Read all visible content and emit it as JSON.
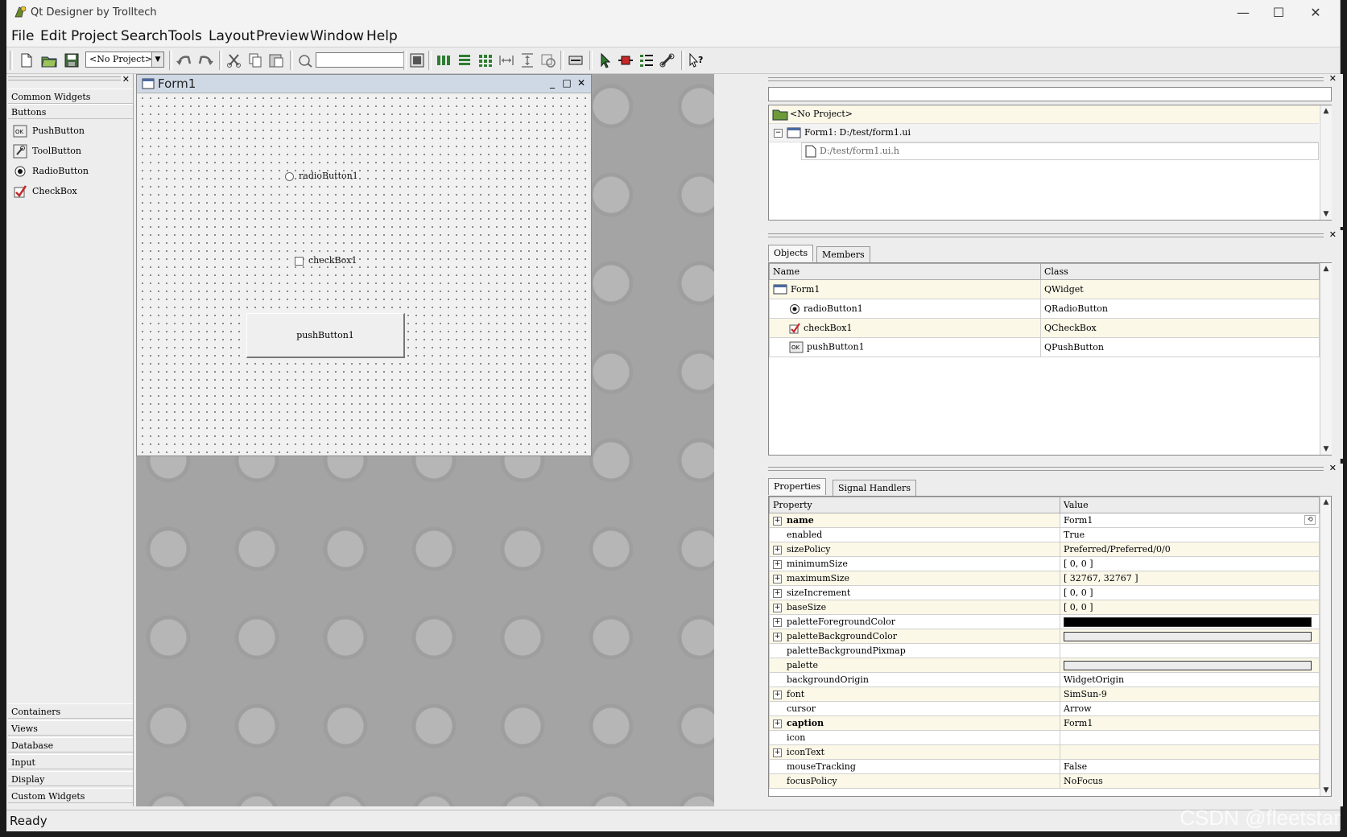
{
  "window": {
    "title": "Qt Designer by Trolltech",
    "minimize": "—",
    "maximize": "☐",
    "close": "✕"
  },
  "menu": [
    "File",
    "Edit",
    "Project",
    "Search",
    "Tools",
    "Layout",
    "Preview",
    "Window",
    "Help"
  ],
  "toolbar": {
    "project_combo": "<No Project>",
    "search_value": ""
  },
  "toolbox": {
    "close": "✕",
    "top_categories": [
      "Common Widgets",
      "Buttons"
    ],
    "widgets": [
      "PushButton",
      "ToolButton",
      "RadioButton",
      "CheckBox"
    ],
    "bottom_categories": [
      "Containers",
      "Views",
      "Database",
      "Input",
      "Display",
      "Custom Widgets"
    ]
  },
  "form": {
    "title": "Form1",
    "radio_label": "radioButton1",
    "checkbox_label": "checkBox1",
    "push_label": "pushButton1"
  },
  "project_panel": {
    "project": "<No Project>",
    "form_entry": "Form1: D:/test/form1.ui",
    "file_entry": "D:/test/form1.ui.h"
  },
  "objects_panel": {
    "tabs": [
      "Objects",
      "Members"
    ],
    "headers": [
      "Name",
      "Class"
    ],
    "rows": [
      {
        "name": "Form1",
        "cls": "QWidget"
      },
      {
        "name": "radioButton1",
        "cls": "QRadioButton"
      },
      {
        "name": "checkBox1",
        "cls": "QCheckBox"
      },
      {
        "name": "pushButton1",
        "cls": "QPushButton"
      }
    ]
  },
  "properties_panel": {
    "tabs": [
      "Properties",
      "Signal Handlers"
    ],
    "headers": [
      "Property",
      "Value"
    ],
    "rows": [
      {
        "p": "name",
        "v": "Form1",
        "plus": true,
        "bold": true
      },
      {
        "p": "enabled",
        "v": "True",
        "plus": false,
        "bold": false
      },
      {
        "p": "sizePolicy",
        "v": "Preferred/Preferred/0/0",
        "plus": true,
        "bold": false
      },
      {
        "p": "minimumSize",
        "v": "[ 0, 0 ]",
        "plus": true,
        "bold": false
      },
      {
        "p": "maximumSize",
        "v": "[ 32767, 32767 ]",
        "plus": true,
        "bold": false
      },
      {
        "p": "sizeIncrement",
        "v": "[ 0, 0 ]",
        "plus": true,
        "bold": false
      },
      {
        "p": "baseSize",
        "v": "[ 0, 0 ]",
        "plus": true,
        "bold": false
      },
      {
        "p": "paletteForegroundColor",
        "v": "",
        "plus": true,
        "bold": false,
        "swatch": "#000000"
      },
      {
        "p": "paletteBackgroundColor",
        "v": "",
        "plus": true,
        "bold": false,
        "swatch": "#ececec"
      },
      {
        "p": "paletteBackgroundPixmap",
        "v": "",
        "plus": false,
        "bold": false
      },
      {
        "p": "palette",
        "v": "",
        "plus": false,
        "bold": false,
        "swatch": "#ececec"
      },
      {
        "p": "backgroundOrigin",
        "v": "WidgetOrigin",
        "plus": false,
        "bold": false
      },
      {
        "p": "font",
        "v": "SimSun-9",
        "plus": true,
        "bold": false
      },
      {
        "p": "cursor",
        "v": "Arrow",
        "plus": false,
        "bold": false
      },
      {
        "p": "caption",
        "v": "Form1",
        "plus": true,
        "bold": true
      },
      {
        "p": "icon",
        "v": "",
        "plus": false,
        "bold": false
      },
      {
        "p": "iconText",
        "v": "",
        "plus": true,
        "bold": false
      },
      {
        "p": "mouseTracking",
        "v": "False",
        "plus": false,
        "bold": false
      },
      {
        "p": "focusPolicy",
        "v": "NoFocus",
        "plus": false,
        "bold": false
      }
    ]
  },
  "status": {
    "text": "Ready"
  },
  "watermark": "CSDN @fleetstar"
}
